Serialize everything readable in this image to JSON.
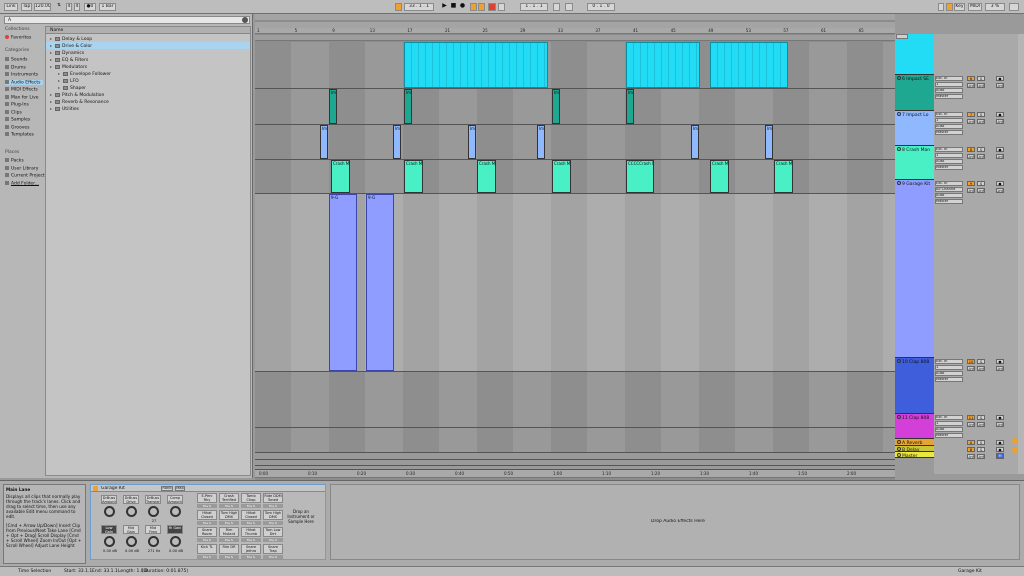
{
  "topbar": {
    "link": "Link",
    "tap": "Tap",
    "tempo": "120.00",
    "sig_num": "4",
    "sig_den": "4",
    "metro": "●0",
    "quant": "1 Bar",
    "pos": "33 . 1 . 1",
    "loop_start": "1 . 1 . 1",
    "loop_len": "0 . 1 . 0",
    "key": "Key",
    "midi": "MIDI",
    "cpu": "3 %"
  },
  "browser": {
    "search": "A",
    "collections_header": "Collections",
    "favorites": "Favorites",
    "categories_header": "Categories",
    "categories": [
      "Sounds",
      "Drums",
      "Instruments",
      "Audio Effects",
      "MIDI Effects",
      "Max for Live",
      "Plug-Ins",
      "Clips",
      "Samples",
      "Grooves",
      "Templates"
    ],
    "places_header": "Places",
    "places": [
      "Packs",
      "User Library",
      "Current Project",
      "Add Folder..."
    ],
    "name_header": "Name",
    "items": [
      "Delay & Loop",
      "Drive & Color",
      "Dynamics",
      "EQ & Filters",
      "Modulators",
      "Envelope Follower",
      "LFO",
      "Shaper",
      "Pitch & Modulation",
      "Reverb & Resonance",
      "Utilities"
    ]
  },
  "ruler": [
    "1",
    "5",
    "9",
    "13",
    "17",
    "21",
    "25",
    "29",
    "33",
    "37",
    "41",
    "45",
    "49",
    "53",
    "57",
    "61",
    "65"
  ],
  "time_ruler": [
    "0:00",
    "0:10",
    "0:20",
    "0:30",
    "0:40",
    "0:50",
    "1:00",
    "1:10",
    "1:20",
    "1:30",
    "1:40",
    "1:50",
    "2:00"
  ],
  "tracks": [
    {
      "name": "6 Impact SE",
      "color": "#1ea892",
      "clip": "Imp"
    },
    {
      "name": "7 Impact Lo",
      "color": "#8fb8ff",
      "clip": "Imp"
    },
    {
      "name": "8 Crash Man",
      "color": "#49f0c6",
      "clip": "Crash Ma"
    },
    {
      "name": "9 Garage Kit",
      "color": "#8e9dff",
      "clip": "9-G"
    },
    {
      "name": "10 Clap 808",
      "color": "#3e5edb",
      "clip": ""
    },
    {
      "name": "11 Clap 808",
      "color": "#d43fd9",
      "clip": ""
    },
    {
      "name": "A Reverb",
      "color": "#e8a431",
      "clip": ""
    },
    {
      "name": "B Delay",
      "color": "#c9c43a",
      "clip": ""
    },
    {
      "name": "Master",
      "color": "#eae83e",
      "clip": ""
    }
  ],
  "clip_labels": {
    "crash_special": "CCCCCrash Ma"
  },
  "mixer": {
    "ext_in": "Ext. In",
    "input_ch": "1",
    "in_label": "In",
    "auto_label": "Auto",
    "off_label": "Off",
    "out": "Master",
    "all_channels": "All Channe",
    "vol": "-inf",
    "sends": [
      "A",
      "B"
    ],
    "track_numbers": [
      "6",
      "7",
      "8",
      "9",
      "10",
      "11",
      "A",
      "B"
    ],
    "master_label": "M"
  },
  "detail": {
    "info_title": "Main Lane",
    "info_text": "Displays all clips that normally play through the track's lanes. Click and drag to select time, then use any available Edit menu command to edit.",
    "info_shortcuts": "[Cmd + Arrow Up/Down] Insert Clip from Previous/Next Take Lane  [Cmd + Opt + Drag] Scroll Display  [Cmd + Scroll Wheel] Zoom In/Out  [Opt + Scroll Wheel] Adjust Lane Height",
    "rack_title": "Garage Kit",
    "rack_btn1": "Rand",
    "rack_btn2": "Map",
    "macros": [
      "DrBuss Amount",
      "DrBuss Drive",
      "DrBuss Transien",
      "Comp Amount",
      "Low Gain",
      "Mid Gain",
      "Mid Freq",
      "Hi Gain"
    ],
    "macro_vals": [
      "",
      "27",
      "",
      "0.00 dB",
      "0.00 dB",
      "271 Hz",
      "0.00 dB"
    ],
    "pads": [
      "E-Perc Rhy",
      "Crash Terrified",
      "Tamb Chop",
      "Ride DDM Toned",
      "Hihat Closed",
      "Tom High DMX",
      "Hihat Closed",
      "Tom High DMS",
      "Snare Room",
      "Rim Mutant",
      "Hihat Thumb",
      "Tom Low Dirt",
      "Kick TL",
      "Rim DR",
      "Snare Jethro",
      "Snare Trap"
    ],
    "drop_instrument": "Drop an Instrument or Sample Here",
    "drop_fx": "Drop Audio Effects Here"
  },
  "status": {
    "label": "Time Selection",
    "start": "Start: 33.1.1",
    "end": "End: 33.1.1",
    "length": "Length: 1.0.0",
    "duration": "(Duration: 0:01.875)",
    "right": "Garage Kit"
  }
}
